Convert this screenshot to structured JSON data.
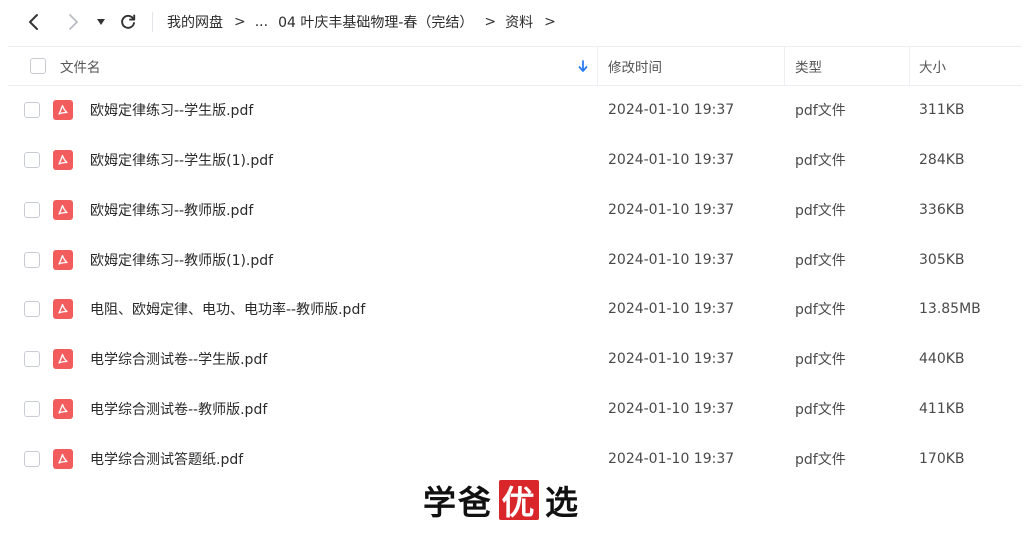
{
  "breadcrumb": {
    "items": [
      "我的网盘",
      "...",
      "04 叶庆丰基础物理-春（完结）",
      "资料"
    ],
    "separator": ">"
  },
  "table": {
    "headers": {
      "name": "文件名",
      "modified": "修改时间",
      "type": "类型",
      "size": "大小"
    },
    "sort_icon": "sort-down-arrow-icon",
    "rows": [
      {
        "name": "欧姆定律练习--学生版.pdf",
        "modified": "2024-01-10 19:37",
        "type": "pdf文件",
        "size": "311KB"
      },
      {
        "name": "欧姆定律练习--学生版(1).pdf",
        "modified": "2024-01-10 19:37",
        "type": "pdf文件",
        "size": "284KB"
      },
      {
        "name": "欧姆定律练习--教师版.pdf",
        "modified": "2024-01-10 19:37",
        "type": "pdf文件",
        "size": "336KB"
      },
      {
        "name": "欧姆定律练习--教师版(1).pdf",
        "modified": "2024-01-10 19:37",
        "type": "pdf文件",
        "size": "305KB"
      },
      {
        "name": "电阻、欧姆定律、电功、电功率--教师版.pdf",
        "modified": "2024-01-10 19:37",
        "type": "pdf文件",
        "size": "13.85MB"
      },
      {
        "name": "电学综合测试卷--学生版.pdf",
        "modified": "2024-01-10 19:37",
        "type": "pdf文件",
        "size": "440KB"
      },
      {
        "name": "电学综合测试卷--教师版.pdf",
        "modified": "2024-01-10 19:37",
        "type": "pdf文件",
        "size": "411KB"
      },
      {
        "name": "电学综合测试答题纸.pdf",
        "modified": "2024-01-10 19:37",
        "type": "pdf文件",
        "size": "170KB"
      }
    ]
  },
  "watermark": {
    "left": "学爸",
    "seal": "优",
    "right": "选"
  },
  "colors": {
    "pdf_icon": "#f25c5c",
    "sort_arrow": "#2a7cf0",
    "seal": "#d8262a"
  }
}
